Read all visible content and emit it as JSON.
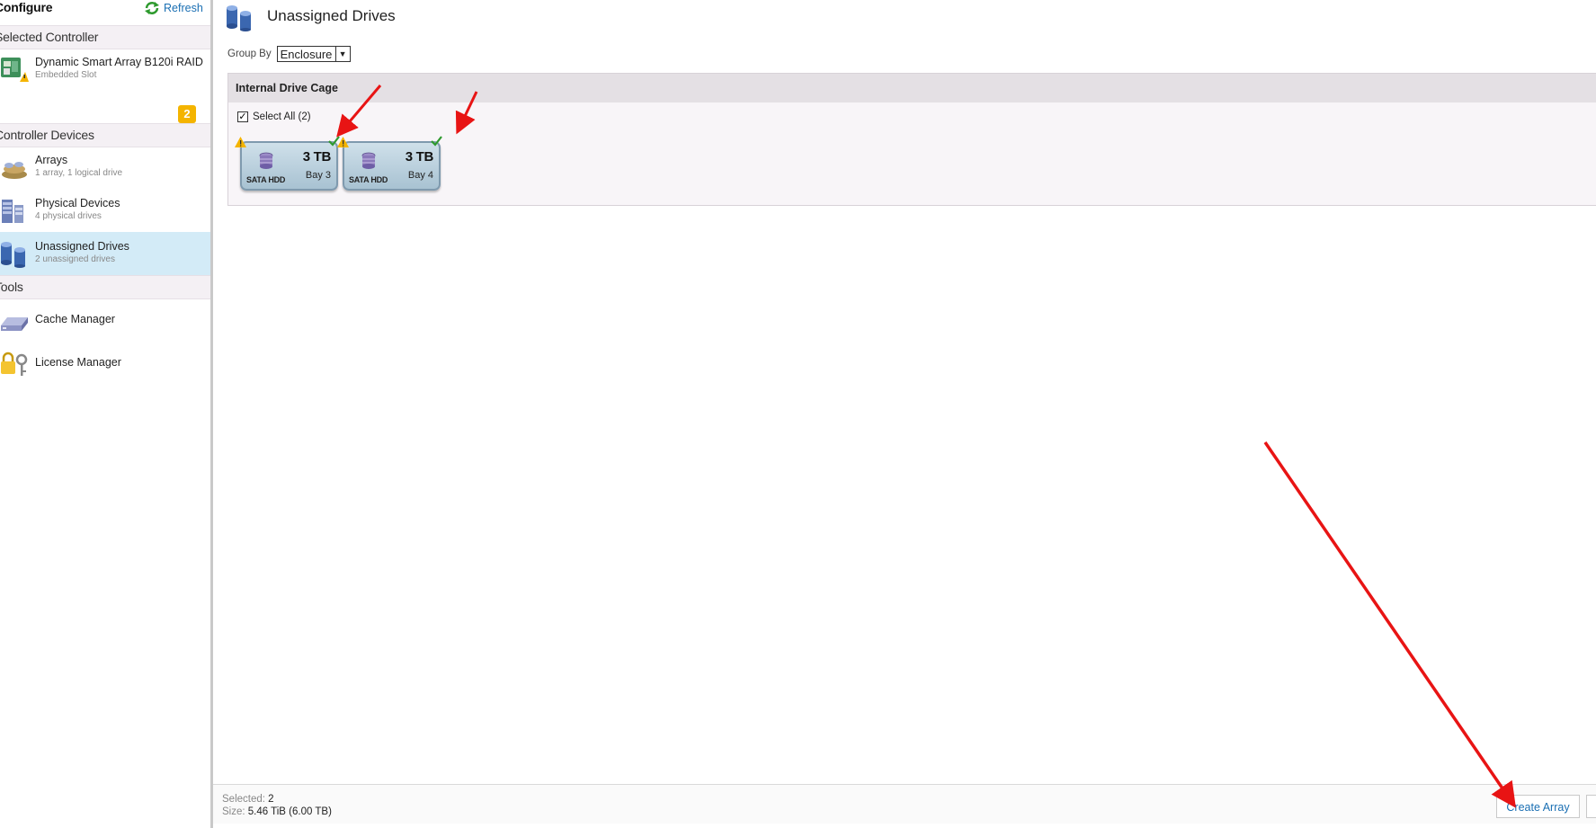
{
  "sidebar": {
    "title": "Configure",
    "refresh_label": "Refresh",
    "sections": {
      "selected_controller": "Selected Controller",
      "controller_devices": "Controller Devices",
      "tools": "Tools"
    },
    "controller": {
      "label": "Dynamic Smart Array B120i RAID",
      "sub": "Embedded Slot",
      "icon": "controller-card-icon"
    },
    "badge_count": "2",
    "items": [
      {
        "label": "Arrays",
        "sub": "1 array, 1 logical drive",
        "icon": "arrays-icon"
      },
      {
        "label": "Physical Devices",
        "sub": "4 physical drives",
        "icon": "physical-devices-icon"
      },
      {
        "label": "Unassigned Drives",
        "sub": "2 unassigned drives",
        "icon": "unassigned-drives-icon",
        "selected": true
      }
    ],
    "tools": [
      {
        "label": "Cache Manager",
        "icon": "cache-manager-icon"
      },
      {
        "label": "License Manager",
        "icon": "license-manager-icon"
      }
    ]
  },
  "main": {
    "title": "Unassigned Drives",
    "group_by_label": "Group By",
    "group_by_value": "Enclosure",
    "panel_title": "Internal Drive Cage",
    "select_all_label": "Select All (2)",
    "select_all_checked": true,
    "drives": [
      {
        "type": "SATA HDD",
        "size": "3 TB",
        "bay": "Bay 3",
        "selected": true
      },
      {
        "type": "SATA HDD",
        "size": "3 TB",
        "bay": "Bay 4",
        "selected": true
      }
    ]
  },
  "footer": {
    "selected_label": "Selected:",
    "selected_value": "2",
    "size_label": "Size:",
    "size_value": "5.46 TiB (6.00 TB)",
    "create_array_label": "Create Array"
  },
  "colors": {
    "link": "#1a6fb3",
    "selected_row": "#d3ebf7",
    "badge": "#f4b400",
    "annotation_arrow": "#e81414"
  }
}
